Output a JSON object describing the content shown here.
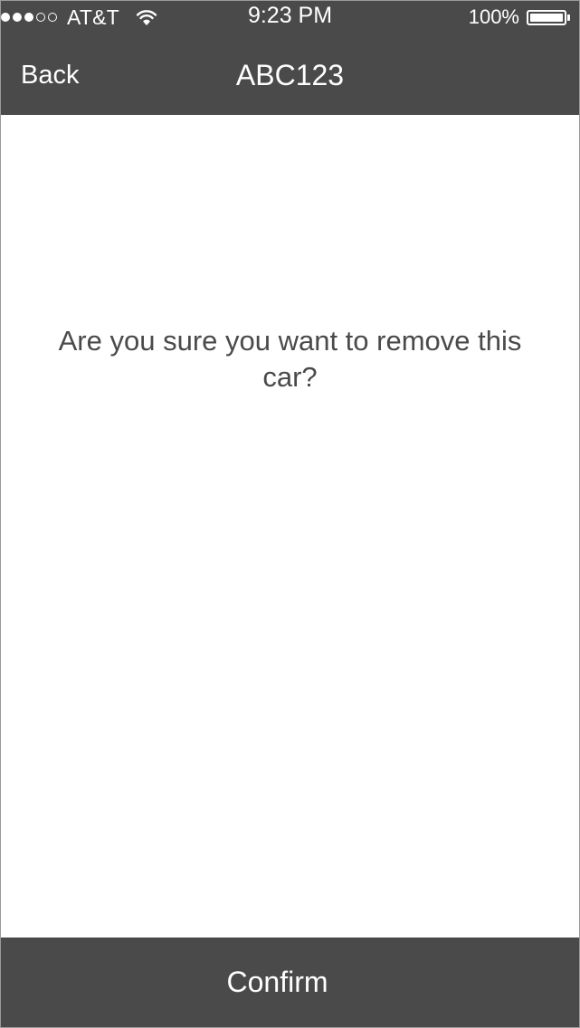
{
  "status_bar": {
    "carrier": "AT&T",
    "time": "9:23 PM",
    "battery": "100%",
    "signal_bars_filled": 3,
    "signal_bars_total": 5,
    "battery_level": 1.0
  },
  "nav": {
    "back_label": "Back",
    "title": "ABC123"
  },
  "dialog": {
    "message": "Are you sure you want to remove this car?"
  },
  "footer": {
    "confirm_label": "Confirm"
  },
  "colors": {
    "bar_background": "#4a4a4a",
    "text_on_bar": "#ffffff",
    "body_text": "#4a4a4a",
    "background": "#ffffff"
  },
  "icons": [
    "signal-dots-icon",
    "wifi-icon",
    "battery-icon"
  ]
}
